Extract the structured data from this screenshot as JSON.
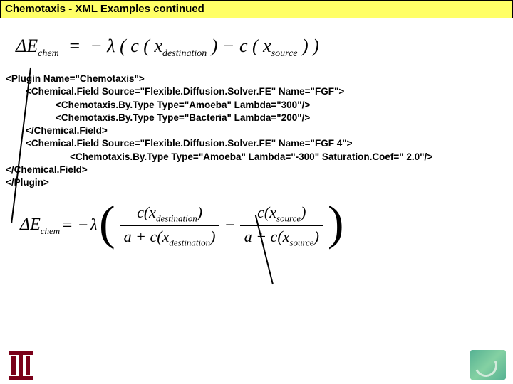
{
  "title": "Chemotaxis - XML Examples continued",
  "equation1": "ΔE_chem = − λ ( c ( x_destination ) − c ( x_source ) )",
  "xml": {
    "l1": "<Plugin Name=\"Chemotaxis\">",
    "l2": "<Chemical.Field Source=\"Flexible.Diffusion.Solver.FE\" Name=\"FGF\">",
    "l3": "<Chemotaxis.By.Type Type=\"Amoeba\" Lambda=\"300\"/>",
    "l4": "<Chemotaxis.By.Type Type=\"Bacteria\" Lambda=\"200\"/>",
    "l5": "</Chemical.Field>",
    "l6": "<Chemical.Field Source=\"Flexible.Diffusion.Solver.FE\" Name=\"FGF 4\">",
    "l7": "<Chemotaxis.By.Type Type=\"Amoeba\" Lambda=\"-300\" Saturation.Coef=\" 2.0\"/>",
    "l8": "</Chemical.Field>",
    "l9": "</Plugin>"
  },
  "equation2": {
    "lhs_delta": "Δ",
    "lhs_E": "E",
    "lhs_sub": "chem",
    "eq": " = −",
    "lambda": "λ",
    "num1_c": "c",
    "num1_x": "x",
    "num1_sub": "destination",
    "den_a": "a",
    "den_plus": " + ",
    "den_c": "c",
    "den_x": "x",
    "den1_sub": "destination",
    "minus": " − ",
    "num2_c": "c",
    "num2_x": "x",
    "num2_sub": "source",
    "den2_sub": "source"
  }
}
